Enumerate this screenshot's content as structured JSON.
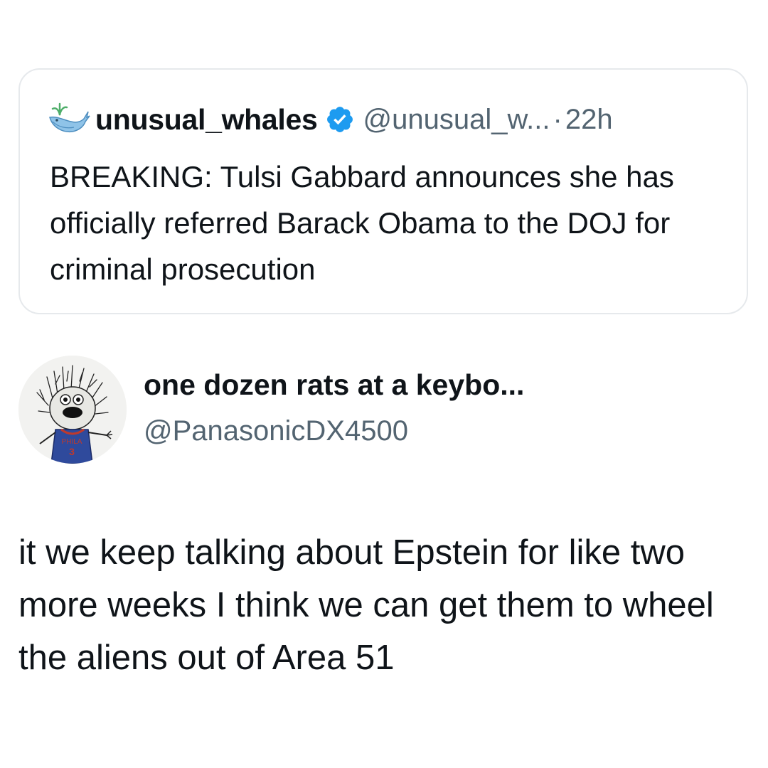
{
  "quoted_tweet": {
    "display_name": "unusual_whales",
    "handle": "@unusual_w...",
    "separator": "·",
    "time": "22h",
    "verified": true,
    "text": "BREAKING: Tulsi Gabbard announces she has officially referred Barack Obama to the DOJ for criminal prosecution",
    "avatar_icon": "whale-logo-icon",
    "badge_color": "#1d9bf0"
  },
  "tweet": {
    "display_name": "one dozen rats at a keybo...",
    "handle": "@PanasonicDX4500",
    "text": "it we keep talking about Epstein for like two more weeks I think we can get them to wheel the aliens out of Area 51",
    "avatar_icon": "sketch-character-avatar-icon",
    "avatar_jersey": {
      "team": "PHILA",
      "number": "3"
    }
  },
  "colors": {
    "text_primary": "#0f1419",
    "text_secondary": "#536471",
    "card_border": "#e6e9ec"
  }
}
